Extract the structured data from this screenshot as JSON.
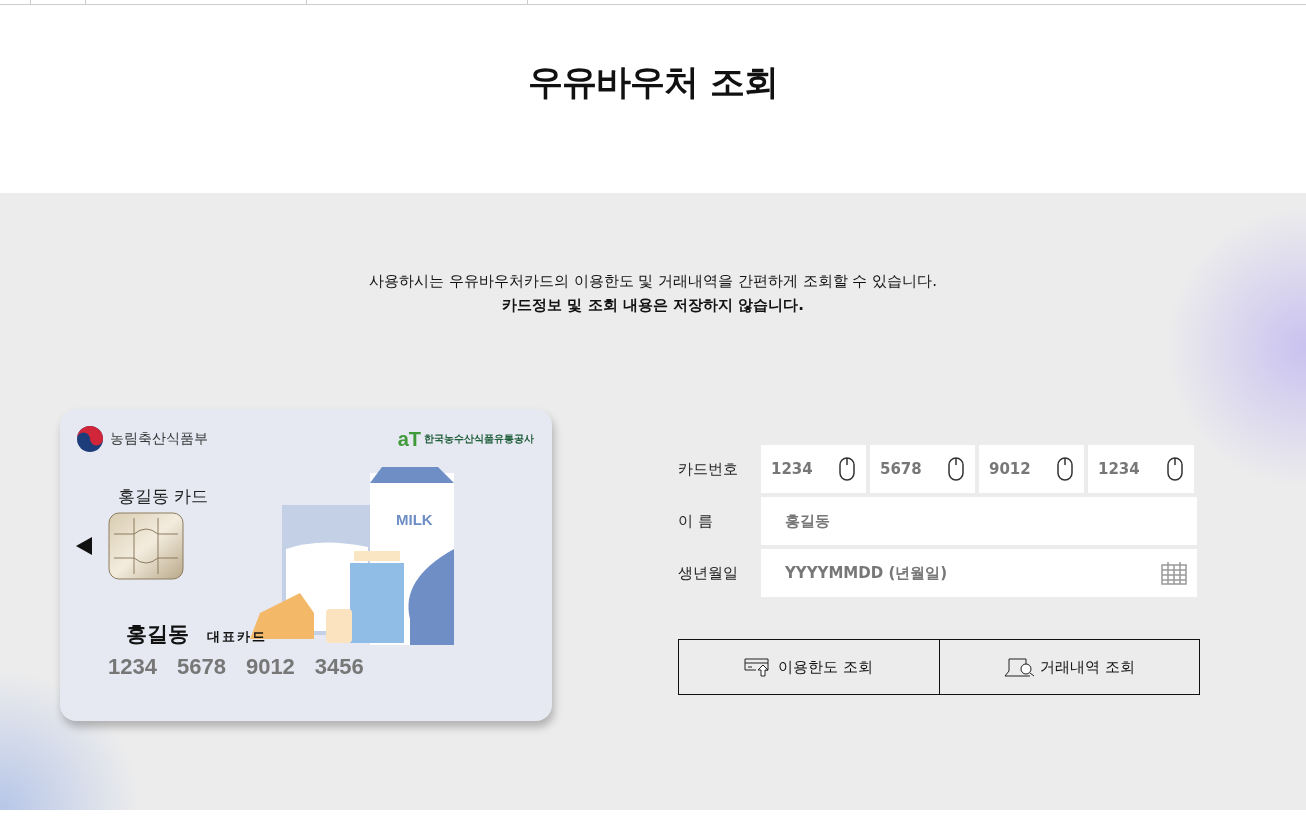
{
  "page_title": "우유바우처 조회",
  "intro": {
    "line_1": "사용하시는 우유바우처카드의 이용한도 및 거래내역을 간편하게 조회할 수 있습니다.",
    "line_2": "카드정보 및 조회 내용은 저장하지 않습니다."
  },
  "card": {
    "ministry": "농림축산식품부",
    "agency_mark": "aT",
    "agency": "한국농수산식품유통공사",
    "card_title": "홍길동 카드",
    "milk_label": "MILK",
    "holder": "홍길동",
    "card_type": "대표카드",
    "number_groups": [
      "1234",
      "5678",
      "9012",
      "3456"
    ]
  },
  "form": {
    "card_number": {
      "label": "카드번호",
      "fields": [
        {
          "placeholder": "1234"
        },
        {
          "placeholder": "5678"
        },
        {
          "placeholder": "9012"
        },
        {
          "placeholder": "1234"
        }
      ]
    },
    "name": {
      "label": "이 름",
      "placeholder": "홍길동"
    },
    "birth": {
      "label": "생년월일",
      "placeholder": "YYYYMMDD (년월일)"
    }
  },
  "buttons": [
    {
      "kind": "limit",
      "label": "이용한도 조회"
    },
    {
      "kind": "history",
      "label": "거래내역 조회"
    }
  ]
}
